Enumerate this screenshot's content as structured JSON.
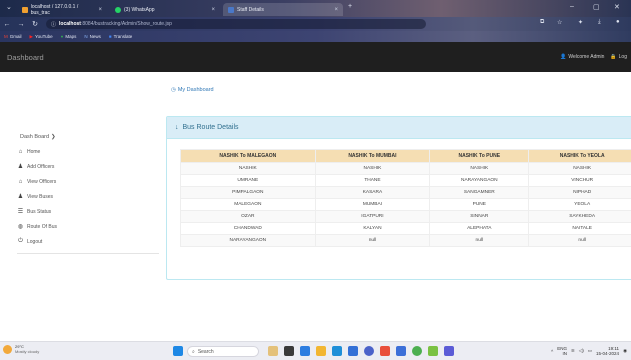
{
  "browser": {
    "tabs": [
      {
        "title": "localhost / 127.0.0.1 / bus_trac"
      },
      {
        "title": "(3) WhatsApp"
      },
      {
        "title": "Staff Details"
      }
    ],
    "url_host": "localhost",
    "url_path": ":8084/bustracking/Admin/Show_route.jsp",
    "bookmarks": [
      "Gmail",
      "YouTube",
      "Maps",
      "News",
      "Translate"
    ]
  },
  "app": {
    "brand": "Dashboard",
    "welcome": "Welcome Admin",
    "logout_short": "Log"
  },
  "sidebar": {
    "header": "Dash Board",
    "items": [
      {
        "label": "Home"
      },
      {
        "label": "Add Officers"
      },
      {
        "label": "View Officers"
      },
      {
        "label": "View Buses"
      },
      {
        "label": "Bus Status"
      },
      {
        "label": "Route Of Bus"
      },
      {
        "label": "Logout"
      }
    ]
  },
  "main": {
    "dashboard_link": "My Dashboard",
    "panel_title": "Bus Route Details",
    "columns": [
      "NASHIK To MALEGAON",
      "NASHIK To MUMBAI",
      "NASHIK To PUNE",
      "NASHIK To YEOLA"
    ],
    "rows": [
      [
        "NASHIK",
        "NASHIK",
        "NASHIK",
        "NASHIK"
      ],
      [
        "UMRANE",
        "THANE",
        "NARAYANGAON",
        "VINCHUR"
      ],
      [
        "PIMPALGAON",
        "KASARA",
        "SANGAMNER",
        "NIPHAD"
      ],
      [
        "MALEGAON",
        "MUMBAI",
        "PUNE",
        "YEOLA"
      ],
      [
        "OZAR",
        "IGATPURI",
        "SINNAR",
        "SAYKHEDA"
      ],
      [
        "CHANDWAD",
        "KALYAN",
        "ALEPHATA",
        "NAITALE"
      ],
      [
        "NARAYANGAON",
        "null",
        "null",
        "null"
      ]
    ]
  },
  "taskbar": {
    "weather_temp": "29°C",
    "weather_desc": "Mostly cloudy",
    "search_placeholder": "Search",
    "lang": "ENG",
    "region": "IN",
    "time": "19:11",
    "date": "15-04-2024"
  },
  "colors": {
    "navbar": "#1f1f1f",
    "panel_head": "#d9edf7",
    "table_head": "#f5deb3",
    "link": "#337ab7"
  }
}
